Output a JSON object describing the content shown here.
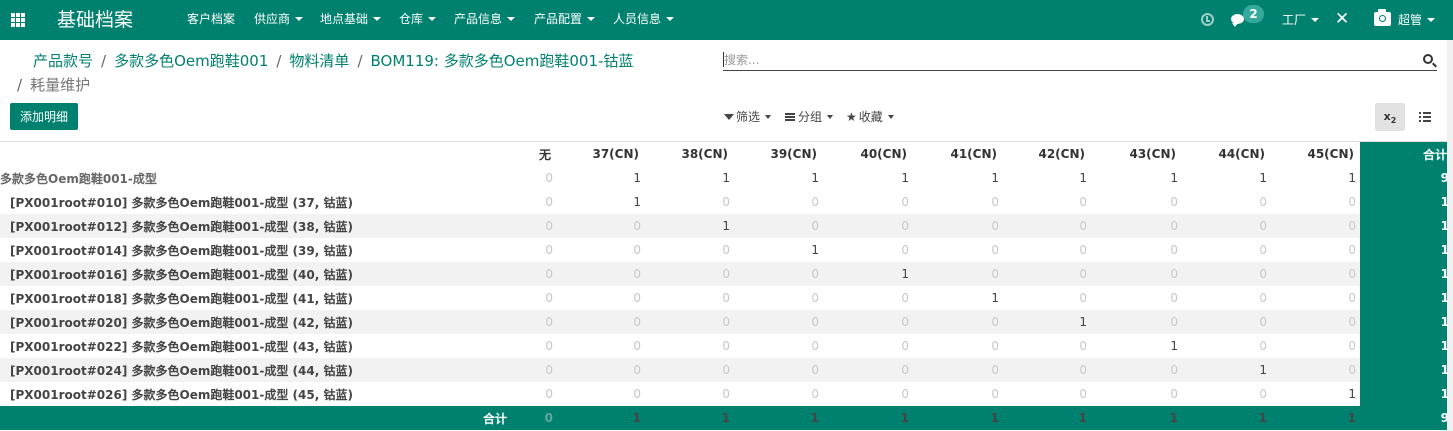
{
  "topbar": {
    "brand": "基础档案",
    "menu": [
      {
        "label": "客户档案",
        "dropdown": false
      },
      {
        "label": "供应商",
        "dropdown": true
      },
      {
        "label": "地点基础",
        "dropdown": true
      },
      {
        "label": "仓库",
        "dropdown": true
      },
      {
        "label": "产品信息",
        "dropdown": true
      },
      {
        "label": "产品配置",
        "dropdown": true
      },
      {
        "label": "人员信息",
        "dropdown": true
      }
    ],
    "chat_count": "2",
    "company": "工厂",
    "user": "超管",
    "accent_color": "#00806f"
  },
  "breadcrumb": {
    "items": [
      "产品款号",
      "多款多色Oem跑鞋001",
      "物料清单",
      "BOM119: 多款多色Oem跑鞋001-钴蓝"
    ],
    "current": "耗量维护"
  },
  "search": {
    "placeholder": "搜索...",
    "value": ""
  },
  "toolbar": {
    "add_label": "添加明细",
    "filter_label": "筛选",
    "group_label": "分组",
    "favorites_label": "收藏",
    "view_sub": "x",
    "view_sub_index": "2"
  },
  "pivot": {
    "columns": [
      "无",
      "37(CN)",
      "38(CN)",
      "39(CN)",
      "40(CN)",
      "41(CN)",
      "42(CN)",
      "43(CN)",
      "44(CN)",
      "45(CN)"
    ],
    "total_label": "合计",
    "parent_row": {
      "label": "多款多色Oem跑鞋001-成型",
      "values": [
        0,
        1,
        1,
        1,
        1,
        1,
        1,
        1,
        1,
        1
      ],
      "total": 9
    },
    "rows": [
      {
        "label": "[PX001root#010] 多款多色Oem跑鞋001-成型 (37, 钴蓝)",
        "values": [
          0,
          1,
          0,
          0,
          0,
          0,
          0,
          0,
          0,
          0
        ],
        "total": 1
      },
      {
        "label": "[PX001root#012] 多款多色Oem跑鞋001-成型 (38, 钴蓝)",
        "values": [
          0,
          0,
          1,
          0,
          0,
          0,
          0,
          0,
          0,
          0
        ],
        "total": 1
      },
      {
        "label": "[PX001root#014] 多款多色Oem跑鞋001-成型 (39, 钴蓝)",
        "values": [
          0,
          0,
          0,
          1,
          0,
          0,
          0,
          0,
          0,
          0
        ],
        "total": 1
      },
      {
        "label": "[PX001root#016] 多款多色Oem跑鞋001-成型 (40, 钴蓝)",
        "values": [
          0,
          0,
          0,
          0,
          1,
          0,
          0,
          0,
          0,
          0
        ],
        "total": 1
      },
      {
        "label": "[PX001root#018] 多款多色Oem跑鞋001-成型 (41, 钴蓝)",
        "values": [
          0,
          0,
          0,
          0,
          0,
          1,
          0,
          0,
          0,
          0
        ],
        "total": 1
      },
      {
        "label": "[PX001root#020] 多款多色Oem跑鞋001-成型 (42, 钴蓝)",
        "values": [
          0,
          0,
          0,
          0,
          0,
          0,
          1,
          0,
          0,
          0
        ],
        "total": 1
      },
      {
        "label": "[PX001root#022] 多款多色Oem跑鞋001-成型 (43, 钴蓝)",
        "values": [
          0,
          0,
          0,
          0,
          0,
          0,
          0,
          1,
          0,
          0
        ],
        "total": 1
      },
      {
        "label": "[PX001root#024] 多款多色Oem跑鞋001-成型 (44, 钴蓝)",
        "values": [
          0,
          0,
          0,
          0,
          0,
          0,
          0,
          0,
          1,
          0
        ],
        "total": 1
      },
      {
        "label": "[PX001root#026] 多款多色Oem跑鞋001-成型 (45, 钴蓝)",
        "values": [
          0,
          0,
          0,
          0,
          0,
          0,
          0,
          0,
          0,
          1
        ],
        "total": 1
      }
    ],
    "footer": {
      "label": "合计",
      "values": [
        0,
        1,
        1,
        1,
        1,
        1,
        1,
        1,
        1,
        1
      ],
      "total": 9
    }
  }
}
